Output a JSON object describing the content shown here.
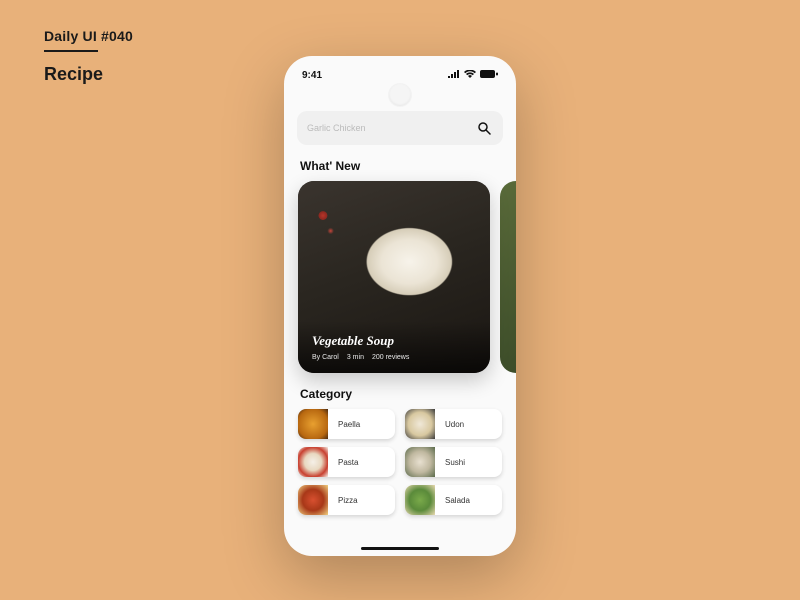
{
  "page": {
    "title": "Daily UI #040",
    "subtitle": "Recipe"
  },
  "status": {
    "time": "9:41"
  },
  "search": {
    "placeholder": "Garlic Chicken"
  },
  "whats_new": {
    "heading": "What' New",
    "card": {
      "title": "Vegetable Soup",
      "author": "By Carol",
      "time": "3 min",
      "reviews": "200 reviews"
    }
  },
  "category": {
    "heading": "Category",
    "items": [
      {
        "label": "Paella",
        "thumb": "paella"
      },
      {
        "label": "Udon",
        "thumb": "udon"
      },
      {
        "label": "Pasta",
        "thumb": "pasta"
      },
      {
        "label": "Sushi",
        "thumb": "sushi"
      },
      {
        "label": "Pizza",
        "thumb": "pizza"
      },
      {
        "label": "Salada",
        "thumb": "salada"
      }
    ]
  }
}
